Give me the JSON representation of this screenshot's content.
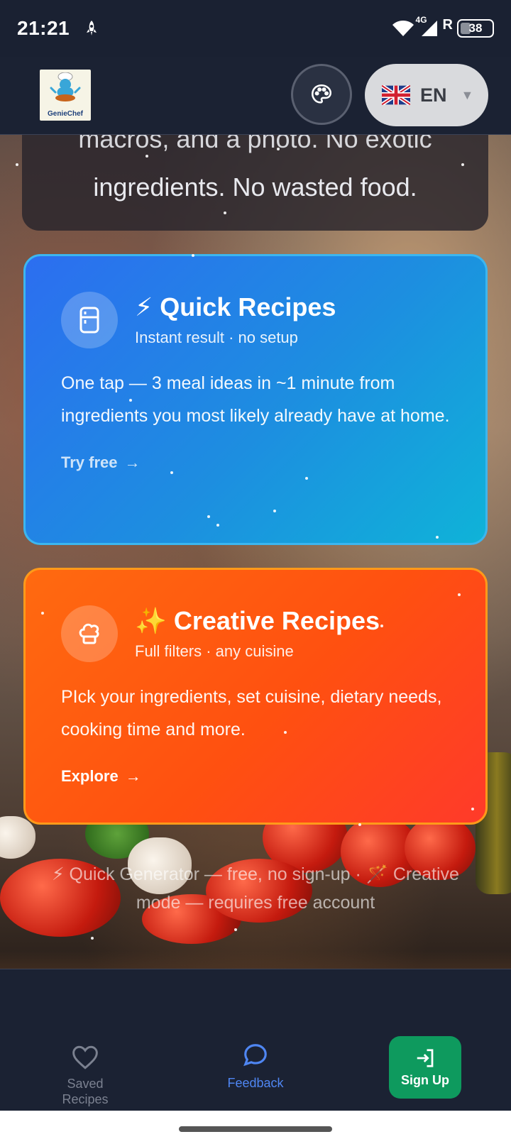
{
  "status_bar": {
    "time": "21:21",
    "network": "4G",
    "roaming": "R",
    "battery": "38"
  },
  "header": {
    "logo_text": "GenieChef",
    "language_code": "EN"
  },
  "intro_card": {
    "line1": "macros, and a photo. No exotic",
    "line2": "ingredients. No wasted food."
  },
  "quick_card": {
    "emoji": "⚡",
    "title": "Quick Recipes",
    "subtitle": "Instant result · no setup",
    "description": "One tap — 3 meal ideas in ~1 minute from ingredients you most likely already have at home.",
    "cta": "Try free",
    "icon": "fridge-icon"
  },
  "creative_card": {
    "emoji": "✨",
    "title": "Creative Recipes",
    "subtitle": "Full filters · any cuisine",
    "description": "PIck your ingredients, set cuisine, dietary needs, cooking time and more.",
    "cta": "Explore",
    "icon": "chef-hat-icon"
  },
  "footnote": {
    "text": "⚡ Quick Generator — free, no sign-up · 🪄 Creative mode — requires free account"
  },
  "bottom_nav": {
    "saved_label": "Saved Recipes",
    "feedback_label": "Feedback",
    "signup_label": "Sign Up"
  },
  "colors": {
    "quick_gradient_start": "#2c6ef0",
    "quick_gradient_end": "#0fb3d8",
    "creative_gradient_start": "#ff6a10",
    "creative_gradient_end": "#ff3a2a",
    "feedback_active": "#4f86f2",
    "signup_green": "#0e9a5e"
  }
}
